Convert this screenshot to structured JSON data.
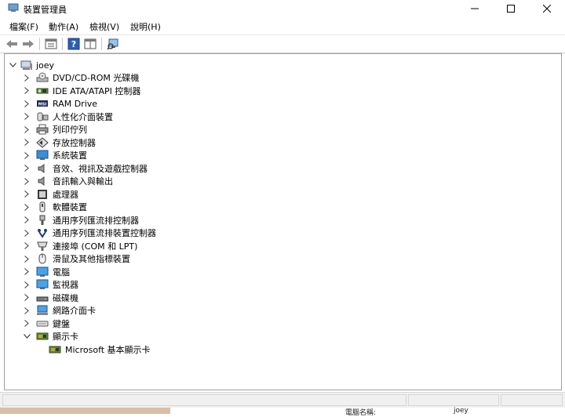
{
  "window": {
    "title": "裝置管理員",
    "minimize_icon": "minimize-icon",
    "maximize_icon": "maximize-icon",
    "close_icon": "close-icon"
  },
  "menu": [
    {
      "label": "檔案(F)"
    },
    {
      "label": "動作(A)"
    },
    {
      "label": "檢視(V)"
    },
    {
      "label": "說明(H)"
    }
  ],
  "toolbar": {
    "buttons": [
      "back-arrow-icon",
      "forward-arrow-icon",
      "properties-icon",
      "help-icon",
      "details-pane-icon",
      "scan-hardware-icon"
    ]
  },
  "tree": {
    "root": {
      "label": "joey",
      "expanded": true,
      "icon": "computer-icon"
    },
    "items": [
      {
        "label": "DVD/CD-ROM 光碟機",
        "icon": "dvd-drive-icon",
        "expanded": false
      },
      {
        "label": "IDE ATA/ATAPI 控制器",
        "icon": "ide-controller-icon",
        "expanded": false
      },
      {
        "label": "RAM Drive",
        "icon": "ram-drive-icon",
        "expanded": false
      },
      {
        "label": "人性化介面裝置",
        "icon": "hid-icon",
        "expanded": false
      },
      {
        "label": "列印佇列",
        "icon": "printer-icon",
        "expanded": false
      },
      {
        "label": "存放控制器",
        "icon": "storage-controller-icon",
        "expanded": false
      },
      {
        "label": "系統裝置",
        "icon": "system-device-icon",
        "expanded": false
      },
      {
        "label": "音效、視訊及遊戲控制器",
        "icon": "speaker-icon",
        "expanded": false
      },
      {
        "label": "音訊輸入與輸出",
        "icon": "audio-io-icon",
        "expanded": false
      },
      {
        "label": "處理器",
        "icon": "processor-icon",
        "expanded": false
      },
      {
        "label": "軟體裝置",
        "icon": "software-device-icon",
        "expanded": false
      },
      {
        "label": "通用序列匯流排控制器",
        "icon": "usb-icon",
        "expanded": false
      },
      {
        "label": "通用序列匯流排裝置控制器",
        "icon": "usb-device-icon",
        "expanded": false
      },
      {
        "label": "連接埠 (COM 和 LPT)",
        "icon": "port-icon",
        "expanded": false
      },
      {
        "label": "滑鼠及其他指標裝置",
        "icon": "mouse-icon",
        "expanded": false
      },
      {
        "label": "電腦",
        "icon": "computer-monitor-icon",
        "expanded": false
      },
      {
        "label": "監視器",
        "icon": "monitor-icon",
        "expanded": false
      },
      {
        "label": "磁碟機",
        "icon": "disk-drive-icon",
        "expanded": false
      },
      {
        "label": "網路介面卡",
        "icon": "network-adapter-icon",
        "expanded": false
      },
      {
        "label": "鍵盤",
        "icon": "keyboard-icon",
        "expanded": false
      },
      {
        "label": "顯示卡",
        "icon": "display-adapter-icon",
        "expanded": true,
        "children": [
          {
            "label": "Microsoft 基本顯示卡",
            "icon": "display-adapter-icon"
          }
        ]
      }
    ]
  },
  "background_window": {
    "label": "電腦名稱:",
    "value": "joey"
  },
  "colors": {
    "accent_blue": "#1e6fc5",
    "pane_border": "#a0a0a0",
    "status_bg": "#f0f0f0"
  }
}
